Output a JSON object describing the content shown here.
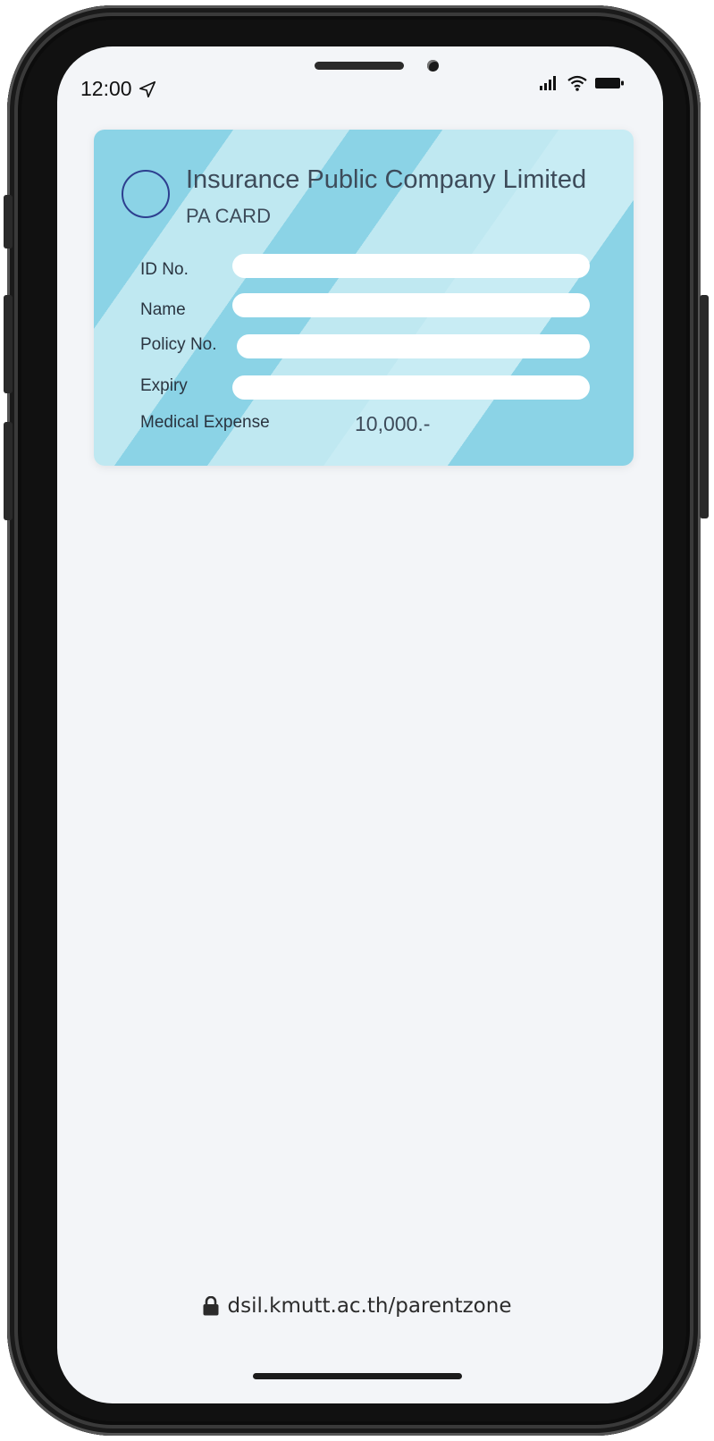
{
  "status_bar": {
    "time": "12:00",
    "location_icon": "location-arrow-icon",
    "signal_icon": "cellular-signal-icon",
    "wifi_icon": "wifi-icon",
    "battery_icon": "battery-icon"
  },
  "card": {
    "company": "Insurance Public Company Limited",
    "type": "PA CARD",
    "fields": [
      {
        "label": "ID No."
      },
      {
        "label": "Name"
      },
      {
        "label": "Policy No."
      },
      {
        "label": "Expiry"
      }
    ],
    "medical_expense_label": "Medical Expense",
    "medical_expense_value": "10,000.-",
    "colors": {
      "stripe_dark": "#8bd3e6",
      "stripe_light": "#bfe8f1",
      "logo_ring": "#2d3f8f"
    }
  },
  "footer": {
    "url": "dsil.kmutt.ac.th/parentzone",
    "lock_icon": "lock-icon"
  }
}
